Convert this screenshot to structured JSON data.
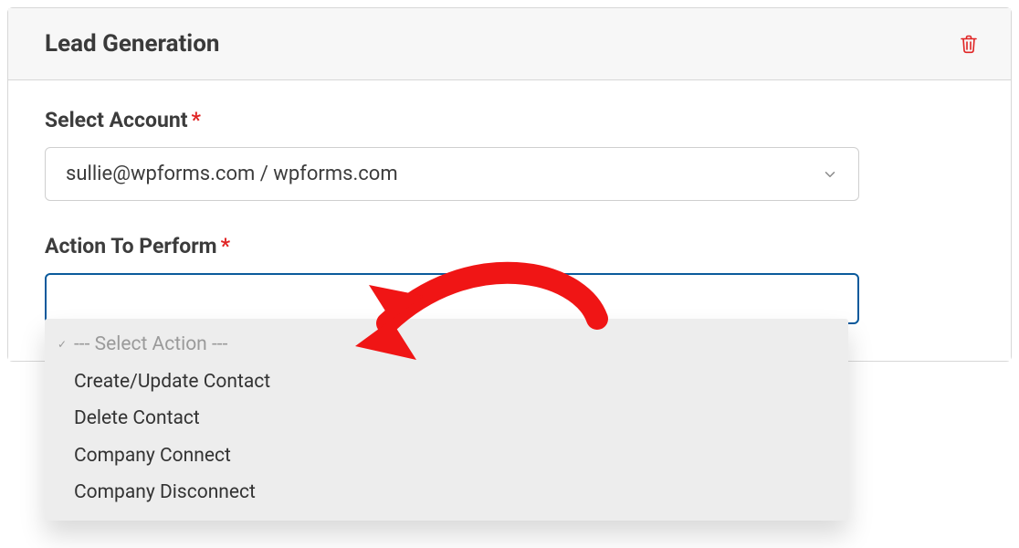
{
  "colors": {
    "accent": "#0a5a9c",
    "danger": "#e02424",
    "annotation": "#f01515"
  },
  "panel": {
    "title": "Lead Generation"
  },
  "account": {
    "label": "Select Account",
    "required_marker": "*",
    "selected": "sullie@wpforms.com / wpforms.com"
  },
  "action": {
    "label": "Action To Perform",
    "required_marker": "*",
    "placeholder": "--- Select Action ---",
    "options": [
      "Create/Update Contact",
      "Delete Contact",
      "Company Connect",
      "Company Disconnect"
    ]
  }
}
